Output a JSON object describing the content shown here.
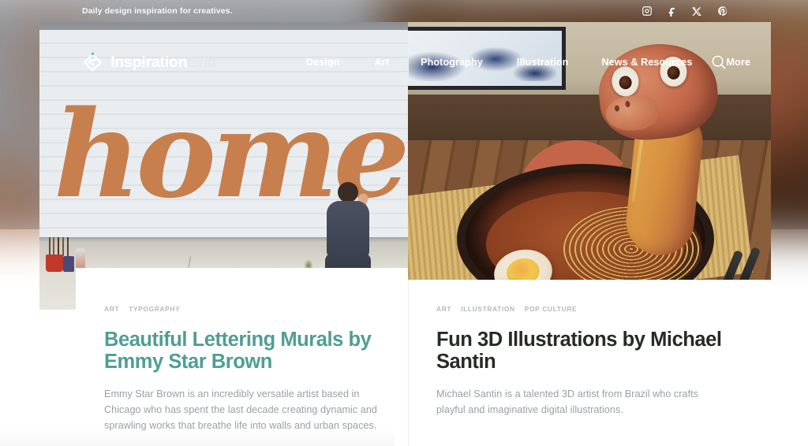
{
  "topbar": {
    "tagline": "Daily design inspiration for creatives.",
    "social": [
      {
        "name": "instagram-icon",
        "label": "Instagram"
      },
      {
        "name": "facebook-icon",
        "label": "Facebook"
      },
      {
        "name": "x-icon",
        "label": "X"
      },
      {
        "name": "pinterest-icon",
        "label": "Pinterest"
      }
    ]
  },
  "header": {
    "logo": {
      "bold": "Inspiration",
      "light": "Grid",
      "mark_color": "#ffffff",
      "dot_color": "#3fc6e0"
    },
    "nav": [
      {
        "label": "Design"
      },
      {
        "label": "Art"
      },
      {
        "label": "Photography"
      },
      {
        "label": "Illustration"
      },
      {
        "label": "News & Resources"
      },
      {
        "label": "More"
      }
    ],
    "search_icon": "search-icon"
  },
  "articles": [
    {
      "categories": [
        "ART",
        "TYPOGRAPHY"
      ],
      "title": "Beautiful Lettering Murals by Emmy Star Brown",
      "excerpt": "Emmy Star Brown is an incredibly versatile artist based in Chicago who has spent the last decade creating dynamic and sprawling works that breathe life into walls and urban spaces.",
      "title_color": "#4e9e95",
      "hero_alt": "Orange script mural reading home painted on white siding with artist",
      "mural_word": "home"
    },
    {
      "categories": [
        "ART",
        "ILLUSTRATION",
        "POP CULTURE"
      ],
      "title": "Fun 3D Illustrations by Michael Santin",
      "excerpt": "Michael Santin is a talented 3D artist from Brazil who crafts playful and imaginative digital illustrations.",
      "title_color": "#262b26",
      "hero_alt": "3D rendered snake slurping noodles from a ramen bowl"
    }
  ]
}
